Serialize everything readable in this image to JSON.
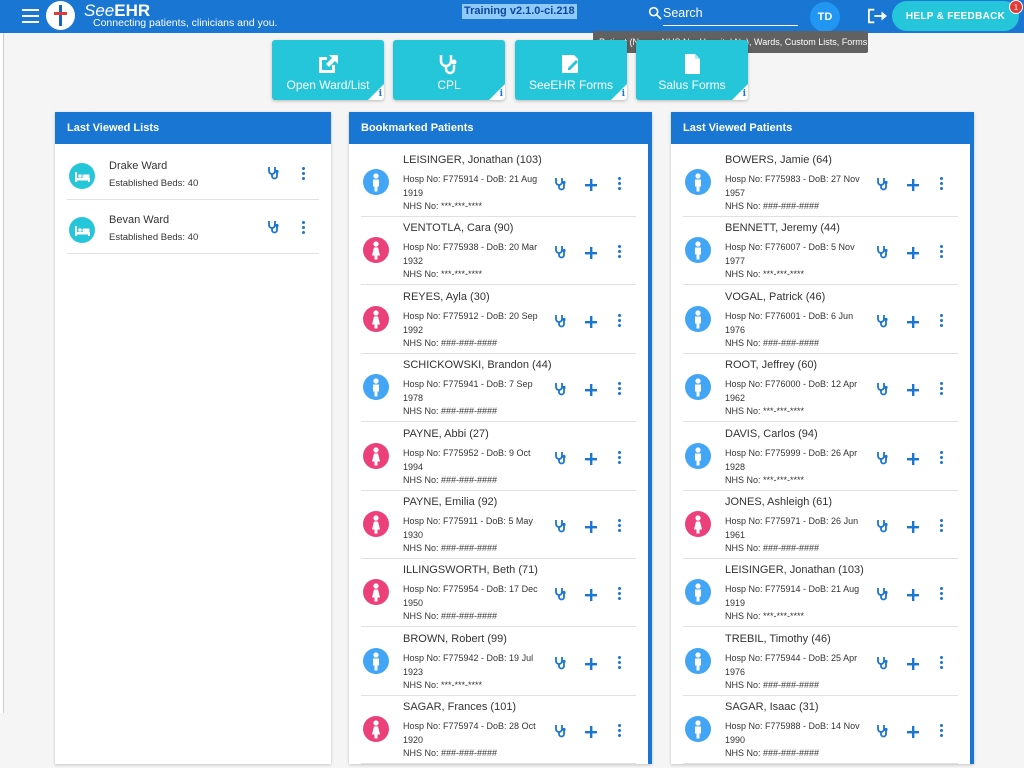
{
  "header": {
    "brand_see": "See",
    "brand_ehr": "EHR",
    "tagline": "Connecting patients, clinicians and you.",
    "version": "Training v2.1.0-ci.218",
    "search_placeholder": "Search",
    "search_tooltip": "Patient (Name, NHS No, Hospital No), Wards, Custom Lists, Forms",
    "avatar": "TD",
    "help_label": "HELP & FEEDBACK",
    "help_badge": "1"
  },
  "tiles": [
    {
      "label": "Open Ward/List",
      "icon": "external-link-icon"
    },
    {
      "label": "CPL",
      "icon": "stethoscope-icon"
    },
    {
      "label": "SeeEHR Forms",
      "icon": "edit-form-icon"
    },
    {
      "label": "Salus Forms",
      "icon": "document-icon"
    }
  ],
  "tile_info": "i",
  "panels": {
    "last_viewed_lists": {
      "title": "Last Viewed Lists",
      "items": [
        {
          "name": "Drake Ward",
          "beds": "Established Beds: 40"
        },
        {
          "name": "Bevan Ward",
          "beds": "Established Beds: 40"
        }
      ]
    },
    "bookmarked": {
      "title": "Bookmarked Patients",
      "items": [
        {
          "name": "LEISINGER, Jonathan (103)",
          "hosp": "Hosp No: F775914 - DoB: 21 Aug 1919",
          "nhs": "NHS No: ***-***-****",
          "sex": "male"
        },
        {
          "name": "VENTOTLA, Cara (90)",
          "hosp": "Hosp No: F775938 - DoB: 20 Mar 1932",
          "nhs": "NHS No: ***-***-****",
          "sex": "female"
        },
        {
          "name": "REYES, Ayla (30)",
          "hosp": "Hosp No: F775912 - DoB: 20 Sep 1992",
          "nhs": "NHS No: ###-###-####",
          "sex": "female"
        },
        {
          "name": "SCHICKOWSKI, Brandon (44)",
          "hosp": "Hosp No: F775941 - DoB: 7 Sep 1978",
          "nhs": "NHS No: ###-###-####",
          "sex": "male"
        },
        {
          "name": "PAYNE, Abbi (27)",
          "hosp": "Hosp No: F775952 - DoB: 9 Oct 1994",
          "nhs": "NHS No: ###-###-####",
          "sex": "female"
        },
        {
          "name": "PAYNE, Emilia (92)",
          "hosp": "Hosp No: F775911 - DoB: 5 May 1930",
          "nhs": "NHS No: ###-###-####",
          "sex": "female"
        },
        {
          "name": "ILLINGSWORTH, Beth (71)",
          "hosp": "Hosp No: F775954 - DoB: 17 Dec 1950",
          "nhs": "NHS No: ###-###-####",
          "sex": "female"
        },
        {
          "name": "BROWN, Robert (99)",
          "hosp": "Hosp No: F775942 - DoB: 19 Jul 1923",
          "nhs": "NHS No: ***-***-****",
          "sex": "male"
        },
        {
          "name": "SAGAR, Frances (101)",
          "hosp": "Hosp No: F775974 - DoB: 28 Oct 1920",
          "nhs": "NHS No: ###-###-####",
          "sex": "female"
        }
      ]
    },
    "last_viewed_patients": {
      "title": "Last Viewed Patients",
      "items": [
        {
          "name": "BOWERS, Jamie (64)",
          "hosp": "Hosp No: F775983 - DoB: 27 Nov 1957",
          "nhs": "NHS No: ###-###-####",
          "sex": "male"
        },
        {
          "name": "BENNETT, Jeremy (44)",
          "hosp": "Hosp No: F776007 - DoB: 5 Nov 1977",
          "nhs": "NHS No: ***-***-****",
          "sex": "male"
        },
        {
          "name": "VOGAL, Patrick (46)",
          "hosp": "Hosp No: F776001 - DoB: 6 Jun 1976",
          "nhs": "NHS No: ###-###-####",
          "sex": "male"
        },
        {
          "name": "ROOT, Jeffrey (60)",
          "hosp": "Hosp No: F776000 - DoB: 12 Apr 1962",
          "nhs": "NHS No: ***-***-****",
          "sex": "male"
        },
        {
          "name": "DAVIS, Carlos (94)",
          "hosp": "Hosp No: F775999 - DoB: 26 Apr 1928",
          "nhs": "NHS No: ***-***-****",
          "sex": "male"
        },
        {
          "name": "JONES, Ashleigh (61)",
          "hosp": "Hosp No: F775971 - DoB: 26 Jun 1961",
          "nhs": "NHS No: ###-###-####",
          "sex": "female"
        },
        {
          "name": "LEISINGER, Jonathan (103)",
          "hosp": "Hosp No: F775914 - DoB: 21 Aug 1919",
          "nhs": "NHS No: ***-***-****",
          "sex": "male"
        },
        {
          "name": "TREBIL, Timothy (46)",
          "hosp": "Hosp No: F775944 - DoB: 25 Apr 1976",
          "nhs": "NHS No: ###-###-####",
          "sex": "male"
        },
        {
          "name": "SAGAR, Isaac (31)",
          "hosp": "Hosp No: F775988 - DoB: 14 Nov 1990",
          "nhs": "NHS No: ###-###-####",
          "sex": "male"
        }
      ]
    }
  },
  "colors": {
    "primary": "#1976d2",
    "accent": "#26c6da",
    "male": "#42a5f5",
    "female": "#ec407a"
  }
}
